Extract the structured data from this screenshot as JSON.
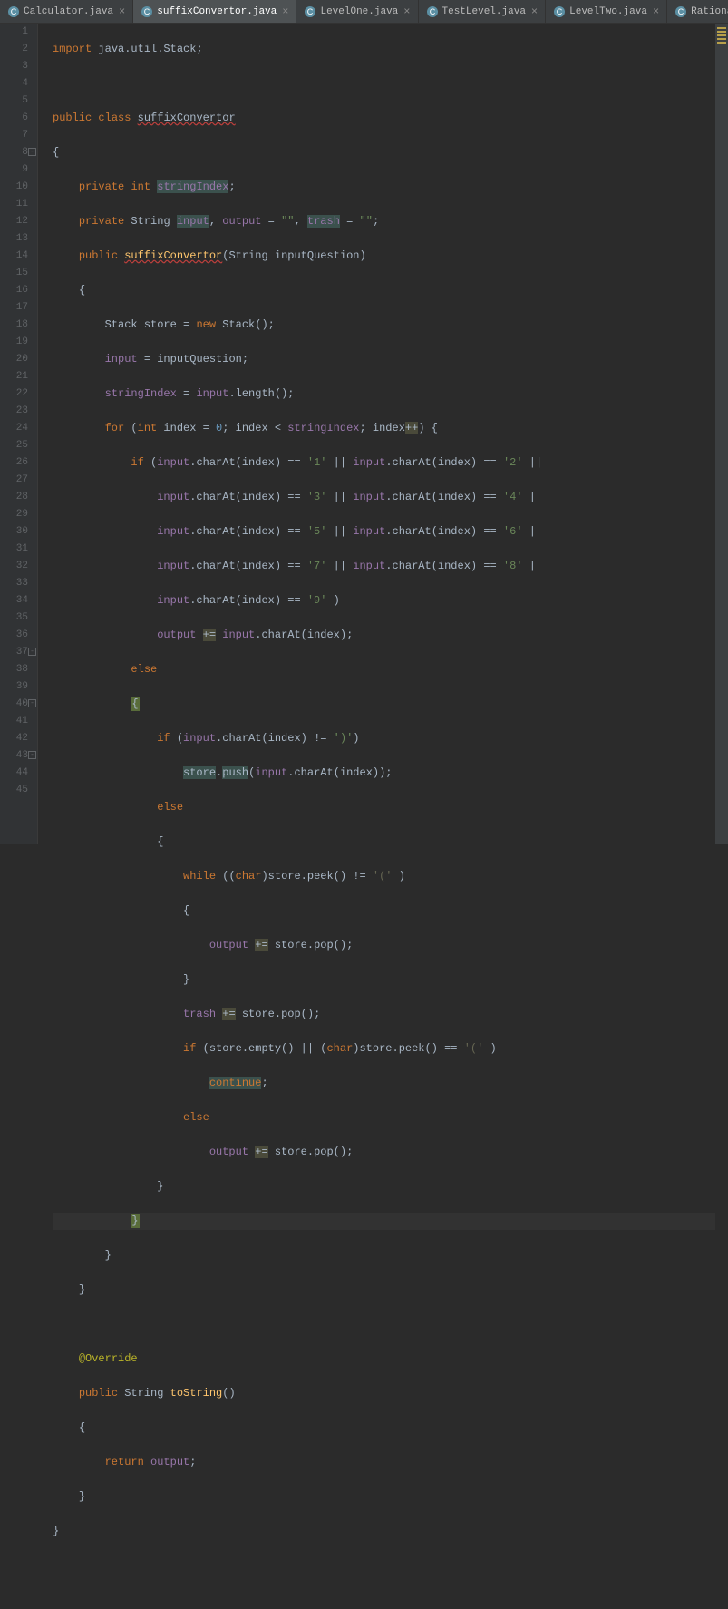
{
  "tabs": [
    {
      "label": "Calculator.java",
      "active": false
    },
    {
      "label": "suffixConvertor.java",
      "active": true
    },
    {
      "label": "LevelOne.java",
      "active": false
    },
    {
      "label": "TestLevel.java",
      "active": false
    },
    {
      "label": "LevelTwo.java",
      "active": false
    },
    {
      "label": "RationalNumbe",
      "active": false,
      "truncated": true
    }
  ],
  "lines": {
    "count": 45,
    "l1": {
      "kw1": "import",
      "t": " java.util.Stack;"
    },
    "l3": {
      "kw1": "public",
      "kw2": "class",
      "cls": "suffixConvertor"
    },
    "l4": {
      "t": "{"
    },
    "l5": {
      "kw1": "private",
      "kw2": "int",
      "f": "stringIndex",
      "s": ";"
    },
    "l6": {
      "kw1": "private",
      "t1": " String ",
      "f1": "input",
      "t2": ", ",
      "f2": "output",
      "t3": " = ",
      "s1": "\"\"",
      "t4": ", ",
      "f3": "trash",
      "t5": " = ",
      "s2": "\"\"",
      "t6": ";"
    },
    "l7": {
      "kw1": "public",
      "m": "suffixConvertor",
      "t1": "(String ",
      "p": "inputQuestion",
      "t2": ")"
    },
    "l8": {
      "t": "{"
    },
    "l9": {
      "t1": "Stack store = ",
      "kw": "new",
      "t2": " Stack();"
    },
    "l10": {
      "f": "input",
      "t1": " = ",
      "p": "inputQuestion",
      "t2": ";"
    },
    "l11": {
      "f1": "stringIndex",
      "t1": " = ",
      "f2": "input",
      "t2": ".length();"
    },
    "l12": {
      "kw1": "for",
      "t1": " (",
      "kw2": "int",
      "t2": " index = ",
      "n1": "0",
      "t3": "; index < ",
      "f": "stringIndex",
      "t4": "; index",
      "op": "++",
      "t5": ") {"
    },
    "l13": {
      "kw": "if",
      "t1": " (",
      "f1": "input",
      "t2": ".charAt(index) == ",
      "s1": "'1'",
      "t3": " || ",
      "f2": "input",
      "t4": ".charAt(index) == ",
      "s2": "'2'",
      "t5": " ||"
    },
    "l14": {
      "f1": "input",
      "t1": ".charAt(index) == ",
      "s1": "'3'",
      "t2": " || ",
      "f2": "input",
      "t3": ".charAt(index) == ",
      "s2": "'4'",
      "t4": " ||"
    },
    "l15": {
      "f1": "input",
      "t1": ".charAt(index) == ",
      "s1": "'5'",
      "t2": " || ",
      "f2": "input",
      "t3": ".charAt(index) == ",
      "s2": "'6'",
      "t4": " ||"
    },
    "l16": {
      "f1": "input",
      "t1": ".charAt(index) == ",
      "s1": "'7'",
      "t2": " || ",
      "f2": "input",
      "t3": ".charAt(index) == ",
      "s2": "'8'",
      "t4": " ||"
    },
    "l17": {
      "f1": "input",
      "t1": ".charAt(index) == ",
      "s1": "'9'",
      "t2": " )"
    },
    "l18": {
      "f1": "output",
      "op": "+=",
      "f2": "input",
      "t": ".charAt(index);"
    },
    "l19": {
      "kw": "else"
    },
    "l20": {
      "t": "{"
    },
    "l21": {
      "kw": "if",
      "t1": " (",
      "f": "input",
      "t2": ".charAt(index) != ",
      "s": "')'",
      "t3": ")"
    },
    "l22": {
      "v": "store",
      "t1": ".",
      "m": "push",
      "t2": "(",
      "f": "input",
      "t3": ".charAt(index));"
    },
    "l23": {
      "kw": "else"
    },
    "l24": {
      "t": "{"
    },
    "l25": {
      "kw1": "while",
      "t1": " ((",
      "kw2": "char",
      "t2": ")store.peek() != ",
      "s": "'('",
      "t3": " )"
    },
    "l26": {
      "t": "{"
    },
    "l27": {
      "f": "output",
      "op": "+=",
      "t": " store.pop();"
    },
    "l28": {
      "t": "}"
    },
    "l29": {
      "f": "trash",
      "op": "+=",
      "t": " store.pop();"
    },
    "l30": {
      "kw1": "if",
      "t1": " (store.empty() || (",
      "kw2": "char",
      "t2": ")store.peek() == ",
      "s": "'('",
      "t3": " )"
    },
    "l31": {
      "kw": "continue",
      "t": ";"
    },
    "l32": {
      "kw": "else"
    },
    "l33": {
      "f": "output",
      "op": "+=",
      "t": " store.pop();"
    },
    "l34": {
      "t": "}"
    },
    "l35": {
      "t": "}"
    },
    "l36": {
      "t": "}"
    },
    "l37": {
      "t": "}"
    },
    "l39": {
      "ann": "@Override"
    },
    "l40": {
      "kw1": "public",
      "t1": " String ",
      "m": "toString",
      "t2": "()"
    },
    "l41": {
      "t": "{"
    },
    "l42": {
      "kw": "return",
      "f": "output",
      "t": ";"
    },
    "l43": {
      "t": "}"
    },
    "l44": {
      "t": "}"
    }
  }
}
